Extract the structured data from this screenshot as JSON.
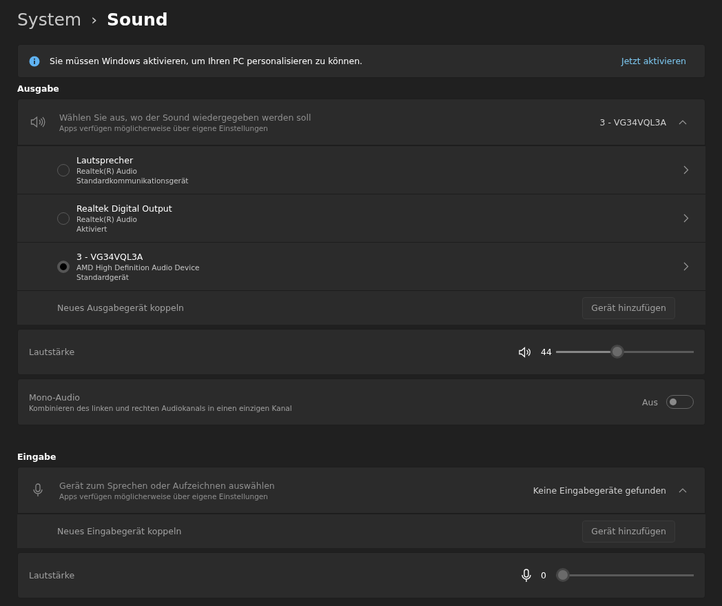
{
  "breadcrumb": {
    "parent": "System",
    "separator": "›",
    "current": "Sound"
  },
  "banner": {
    "message": "Sie müssen Windows aktivieren, um Ihren PC personalisieren zu können.",
    "link": "Jetzt aktivieren"
  },
  "output": {
    "heading": "Ausgabe",
    "selector": {
      "title": "Wählen Sie aus, wo der Sound wiedergegeben werden soll",
      "subtitle": "Apps verfügen möglicherweise über eigene Einstellungen",
      "value": "3 - VG34VQL3A",
      "expanded": true
    },
    "devices": [
      {
        "name": "Lautsprecher",
        "driver": "Realtek(R) Audio",
        "status": "Standardkommunikationsgerät",
        "selected": false
      },
      {
        "name": "Realtek Digital Output",
        "driver": "Realtek(R) Audio",
        "status": "Aktiviert",
        "selected": false
      },
      {
        "name": "3 - VG34VQL3A",
        "driver": "AMD High Definition Audio Device",
        "status": "Standardgerät",
        "selected": true
      }
    ],
    "pair": {
      "label": "Neues Ausgabegerät koppeln",
      "button": "Gerät hinzufügen"
    },
    "volume": {
      "label": "Lautstärke",
      "reading": "44",
      "level": 0.44
    },
    "mono": {
      "title": "Mono-Audio",
      "subtitle": "Kombinieren des linken und rechten Audiokanals in einen einzigen Kanal",
      "state": "Aus",
      "on": false
    }
  },
  "input": {
    "heading": "Eingabe",
    "selector": {
      "title": "Gerät zum Sprechen oder Aufzeichnen auswählen",
      "subtitle": "Apps verfügen möglicherweise über eigene Einstellungen",
      "value": "Keine Eingabegeräte gefunden",
      "expanded": true
    },
    "pair": {
      "label": "Neues Eingabegerät koppeln",
      "button": "Gerät hinzufügen"
    },
    "volume": {
      "label": "Lautstärke",
      "reading": "0",
      "level": 0
    }
  }
}
